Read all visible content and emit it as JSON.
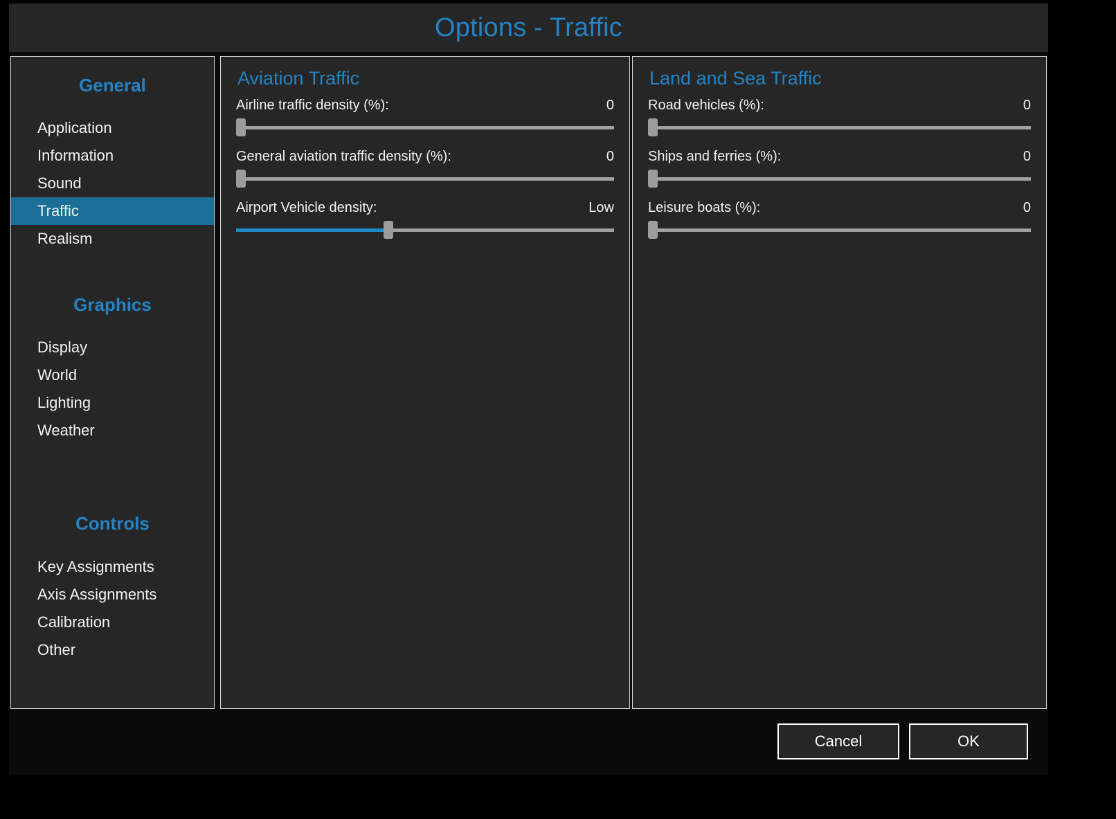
{
  "window": {
    "title": "Options - Traffic",
    "accent_color": "#2383c4",
    "selection_color": "#1b6e96",
    "panel_background": "#262626",
    "page_background": "#000000",
    "text_color": "#f2f2f2"
  },
  "sidebar": {
    "groups": [
      {
        "heading": "General",
        "items": [
          {
            "label": "Application",
            "selected": false
          },
          {
            "label": "Information",
            "selected": false
          },
          {
            "label": "Sound",
            "selected": false
          },
          {
            "label": "Traffic",
            "selected": true
          },
          {
            "label": "Realism",
            "selected": false
          }
        ]
      },
      {
        "heading": "Graphics",
        "items": [
          {
            "label": "Display",
            "selected": false
          },
          {
            "label": "World",
            "selected": false
          },
          {
            "label": "Lighting",
            "selected": false
          },
          {
            "label": "Weather",
            "selected": false
          }
        ]
      },
      {
        "heading": "Controls",
        "items": [
          {
            "label": "Key Assignments",
            "selected": false
          },
          {
            "label": "Axis Assignments",
            "selected": false
          },
          {
            "label": "Calibration",
            "selected": false
          },
          {
            "label": "Other",
            "selected": false
          }
        ]
      }
    ]
  },
  "aviation_panel": {
    "heading": "Aviation Traffic",
    "sliders": [
      {
        "label": "Airline traffic density (%):",
        "value": "0",
        "fill_percent": 0,
        "thumb_percent": 0
      },
      {
        "label": "General aviation traffic density (%):",
        "value": "0",
        "fill_percent": 0,
        "thumb_percent": 0
      },
      {
        "label": "Airport Vehicle density:",
        "value": "Low",
        "fill_percent": 40,
        "thumb_percent": 40
      }
    ]
  },
  "landsea_panel": {
    "heading": "Land and Sea Traffic",
    "sliders": [
      {
        "label": "Road vehicles (%):",
        "value": "0",
        "fill_percent": 0,
        "thumb_percent": 0
      },
      {
        "label": "Ships and ferries (%):",
        "value": "0",
        "fill_percent": 0,
        "thumb_percent": 0
      },
      {
        "label": "Leisure boats (%):",
        "value": "0",
        "fill_percent": 0,
        "thumb_percent": 0
      }
    ]
  },
  "footer": {
    "cancel_label": "Cancel",
    "ok_label": "OK"
  }
}
